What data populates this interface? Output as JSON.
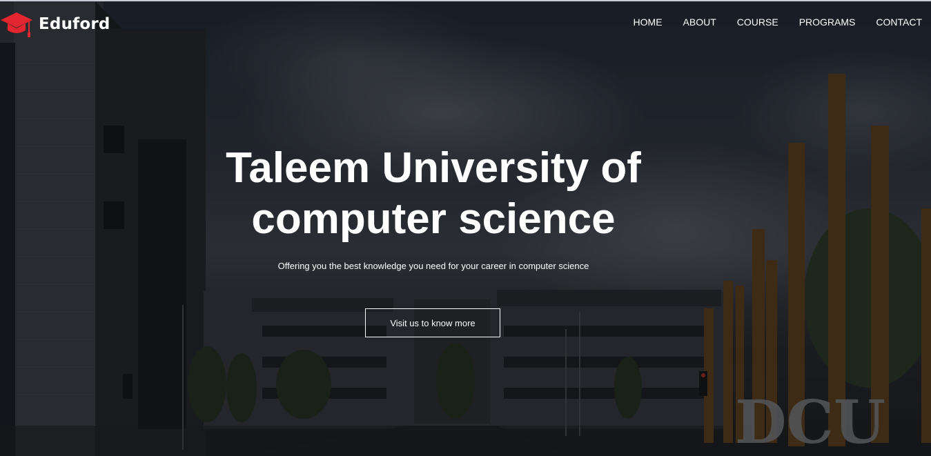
{
  "brand": {
    "name": "Eduford",
    "icon": "graduation-cap-icon",
    "icon_color": "#e3262f"
  },
  "nav": {
    "items": [
      {
        "label": "HOME"
      },
      {
        "label": "ABOUT"
      },
      {
        "label": "COURSE"
      },
      {
        "label": "PROGRAMS"
      },
      {
        "label": "CONTACT"
      }
    ]
  },
  "hero": {
    "title_line1": "Taleem University of",
    "title_line2": "computer science",
    "subtitle": "Offering you the best knowledge you need for your career in computer science",
    "cta_label": "Visit us to know more",
    "background_sign": "DCU"
  }
}
